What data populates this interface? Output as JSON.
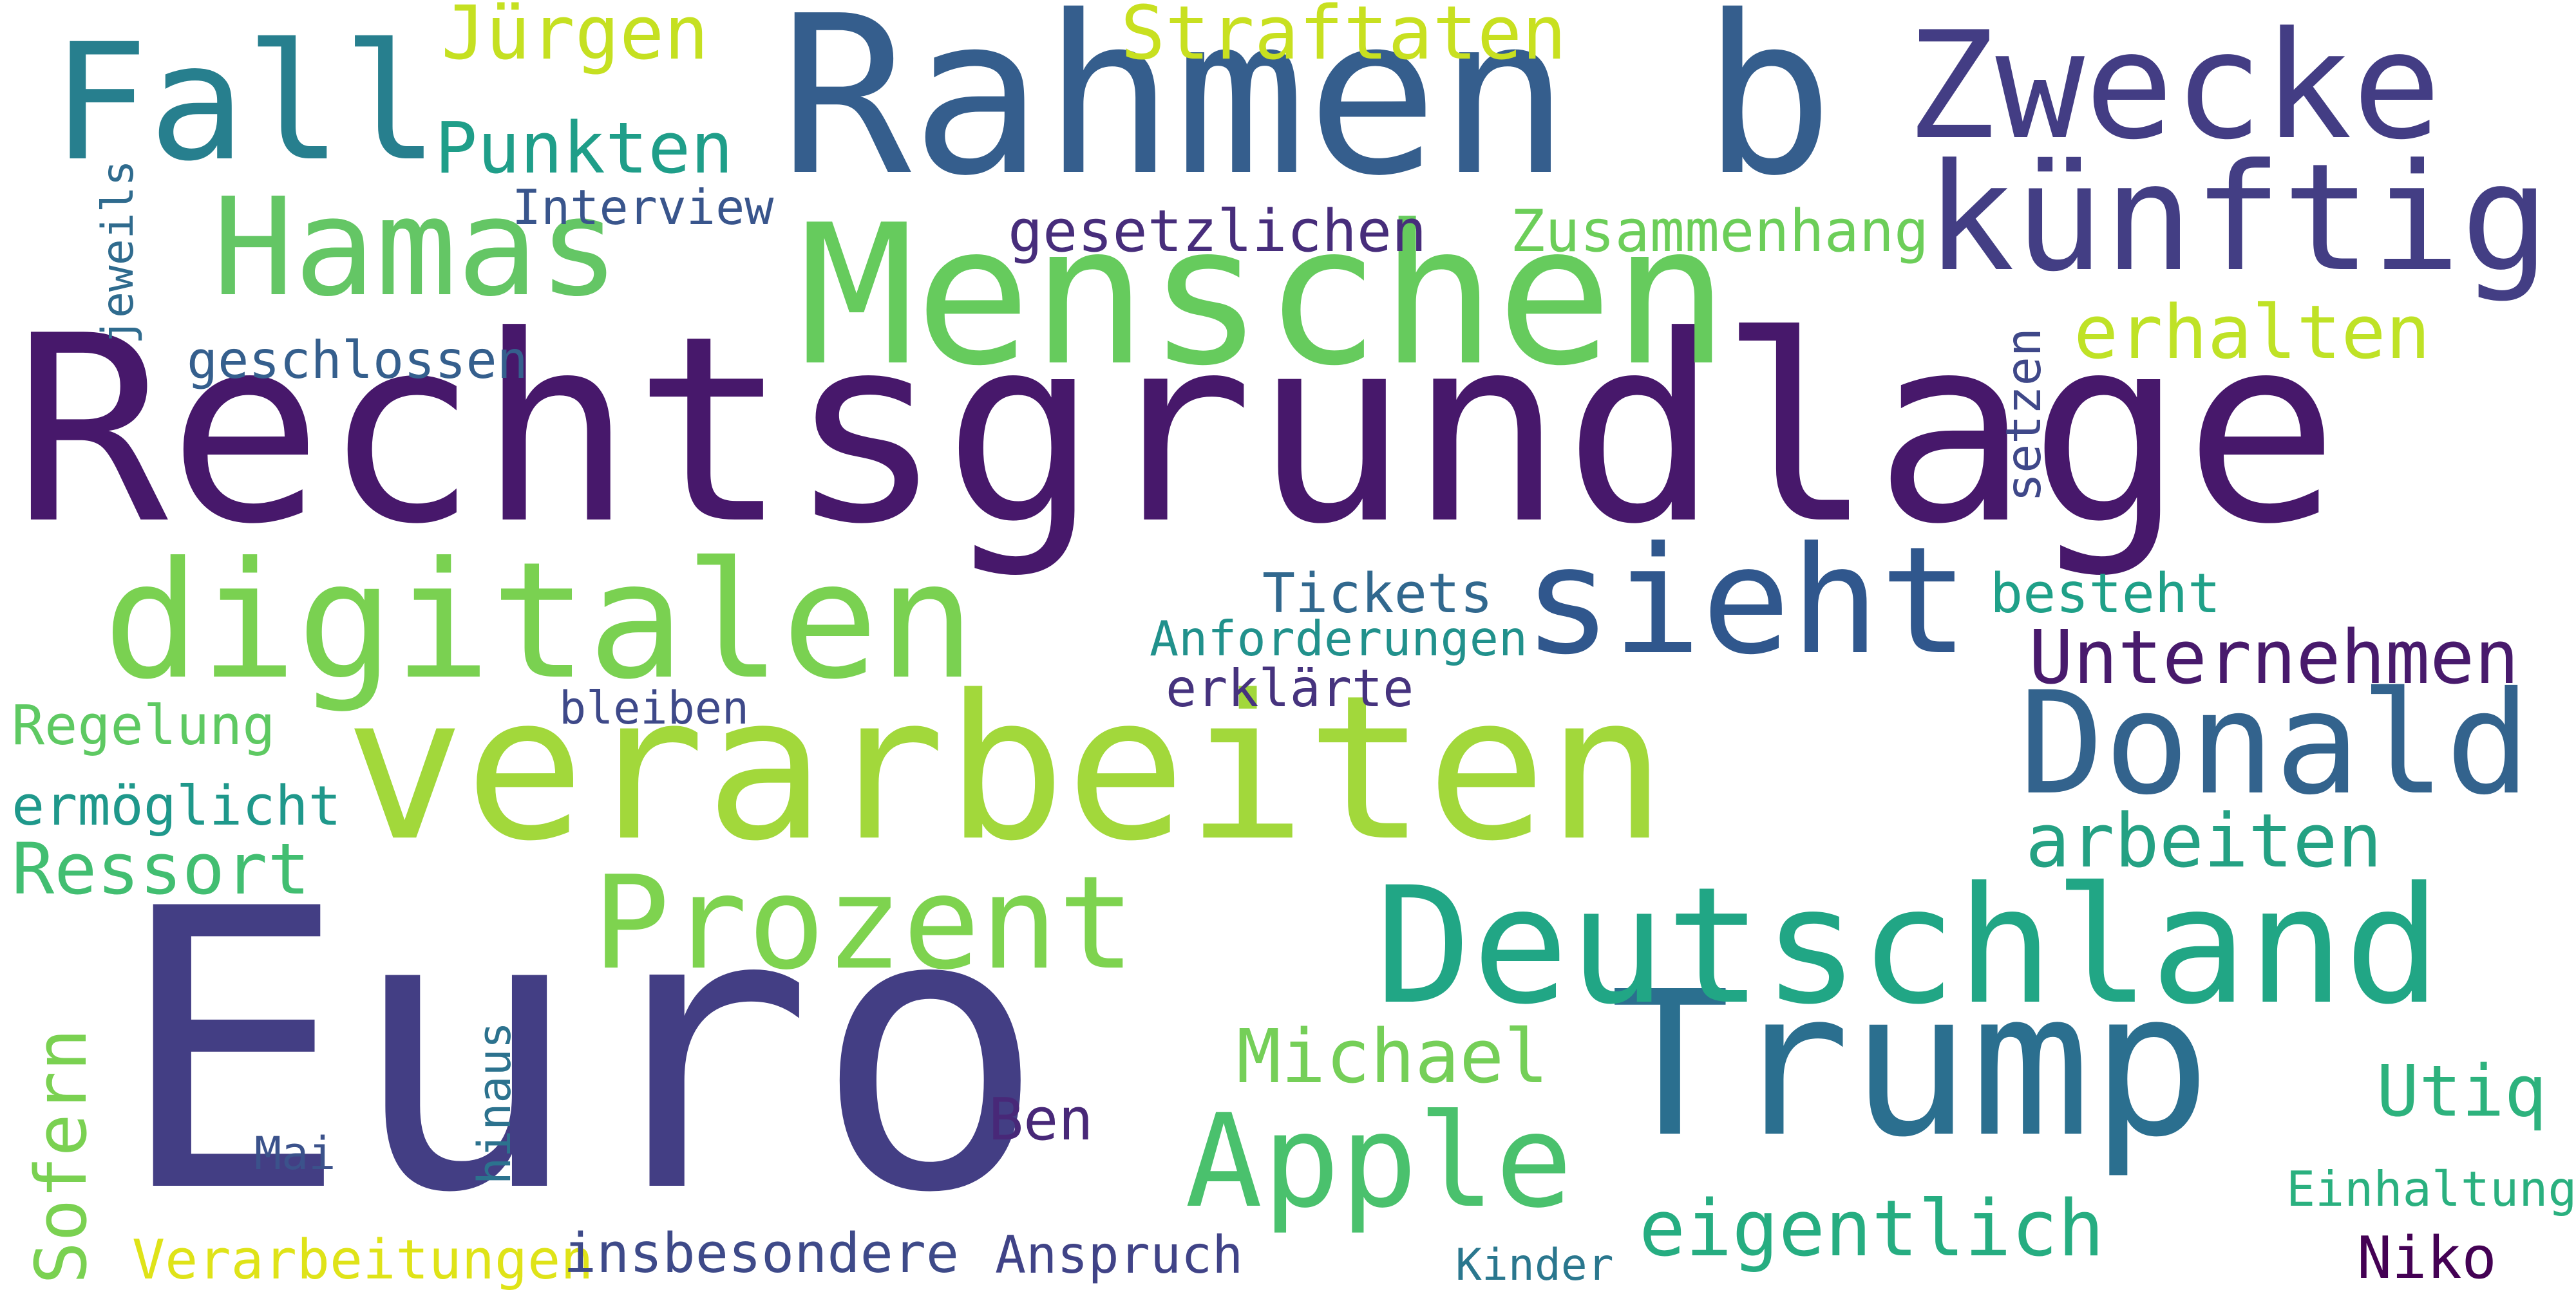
{
  "words": {
    "rechtsgrundlage": {
      "text": "Rechtsgrundlage",
      "color": "#47186b"
    },
    "euro": {
      "text": "Euro",
      "color": "#433e84"
    },
    "verarbeiten": {
      "text": "verarbeiten",
      "color": "#a2d83b"
    },
    "rahmen_b": {
      "text": "Rahmen b",
      "color": "#355e8d"
    },
    "menschen": {
      "text": "Menschen",
      "color": "#66cb5d"
    },
    "trump": {
      "text": "Trump",
      "color": "#2b6f8f"
    },
    "deutschland": {
      "text": "Deutschland",
      "color": "#21a685"
    },
    "digitalen": {
      "text": "digitalen",
      "color": "#7ad151"
    },
    "zwecke": {
      "text": "Zwecke",
      "color": "#433d84"
    },
    "kuenftig": {
      "text": "künftig",
      "color": "#433e84"
    },
    "hamas": {
      "text": "Hamas",
      "color": "#64c665"
    },
    "fall": {
      "text": "Fall",
      "color": "#277f8e"
    },
    "sieht": {
      "text": "sieht",
      "color": "#30578d"
    },
    "donald": {
      "text": "Donald",
      "color": "#33638d"
    },
    "prozent": {
      "text": "Prozent",
      "color": "#7ed34f"
    },
    "apple": {
      "text": "Apple",
      "color": "#4ac16d"
    },
    "unternehmen": {
      "text": "Unternehmen",
      "color": "#481a6c"
    },
    "arbeiten": {
      "text": "arbeiten",
      "color": "#24a183"
    },
    "eigentlich": {
      "text": "eigentlich",
      "color": "#26ad81"
    },
    "michael": {
      "text": "Michael",
      "color": "#75cf58"
    },
    "ressort": {
      "text": "Ressort",
      "color": "#42be71"
    },
    "erhalten": {
      "text": "erhalten",
      "color": "#bfe226"
    },
    "juergen": {
      "text": "Jürgen",
      "color": "#c5e021"
    },
    "straftaten": {
      "text": "Straftaten",
      "color": "#c8e020"
    },
    "punkten": {
      "text": "Punkten",
      "color": "#1f9e89"
    },
    "utiq": {
      "text": "Utiq",
      "color": "#2db27d"
    },
    "ben": {
      "text": "Ben",
      "color": "#482878"
    },
    "niko": {
      "text": "Niko",
      "color": "#440154"
    },
    "interview": {
      "text": "Interview",
      "color": "#39558c"
    },
    "gesetzlichen": {
      "text": "gesetzlichen",
      "color": "#472d7b"
    },
    "zusammenhang": {
      "text": "Zusammenhang",
      "color": "#6cce59"
    },
    "geschlossen": {
      "text": "geschlossen",
      "color": "#355f8d"
    },
    "tickets": {
      "text": "Tickets",
      "color": "#31688e"
    },
    "anforderungen": {
      "text": "Anforderungen",
      "color": "#21918c"
    },
    "besteht": {
      "text": "besteht",
      "color": "#1fa088"
    },
    "erklaerte": {
      "text": "erklärte",
      "color": "#46337e"
    },
    "regelung": {
      "text": "Regelung",
      "color": "#5ec962"
    },
    "bleiben": {
      "text": "bleiben",
      "color": "#3e4989"
    },
    "ermoeglicht": {
      "text": "ermöglicht",
      "color": "#1f988b"
    },
    "mai": {
      "text": "Mai",
      "color": "#3b528b"
    },
    "verarbeitungen": {
      "text": "Verarbeitungen",
      "color": "#dfe318"
    },
    "insbesondere": {
      "text": "insbesondere",
      "color": "#3e4a89"
    },
    "anspruch": {
      "text": "Anspruch",
      "color": "#404387"
    },
    "kinder": {
      "text": "Kinder",
      "color": "#2a778e"
    },
    "einhaltung": {
      "text": "Einhaltung",
      "color": "#2ab07f"
    },
    "jeweils": {
      "text": "jeweils",
      "color": "#2f6b8e"
    },
    "setzen": {
      "text": "setzen",
      "color": "#3f4889"
    },
    "hinaus": {
      "text": "hinaus",
      "color": "#2c728e"
    },
    "sofern": {
      "text": "Sofern",
      "color": "#7ad151"
    }
  }
}
